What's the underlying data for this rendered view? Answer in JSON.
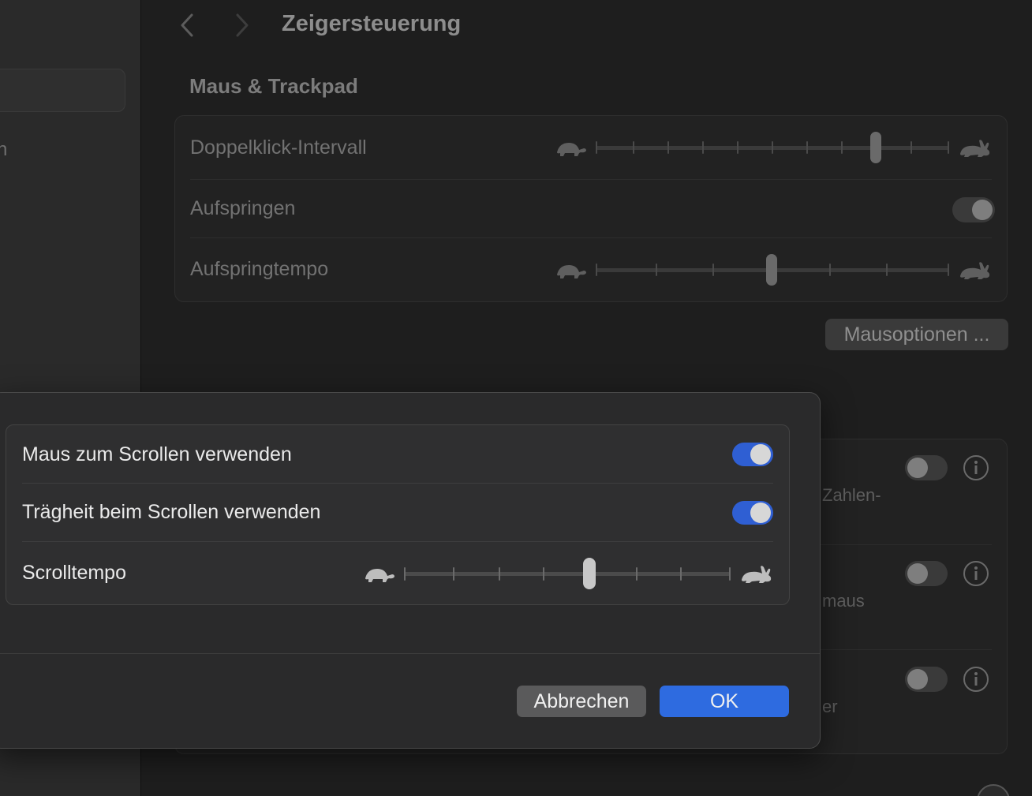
{
  "window": {
    "title": "Zeigersteuerung"
  },
  "sidebar": {
    "visible_fragment": "n"
  },
  "section": {
    "title": "Maus & Trackpad"
  },
  "settings": {
    "double_click": {
      "label": "Doppelklick-Intervall",
      "value_fraction": 0.8
    },
    "spring_loading": {
      "label": "Aufspringen",
      "enabled": true
    },
    "spring_speed": {
      "label": "Aufspringtempo",
      "value_fraction": 0.5
    },
    "mouse_options_button": "Mausoptionen ..."
  },
  "background_rows": [
    {
      "fragment": "Zahlen-",
      "enabled": false
    },
    {
      "fragment": "maus",
      "enabled": false
    },
    {
      "fragment": "er",
      "enabled": false
    }
  ],
  "dialog": {
    "scroll_with_mouse": {
      "label": "Maus zum Scrollen verwenden",
      "enabled": true
    },
    "scroll_inertia": {
      "label": "Trägheit beim Scrollen verwenden",
      "enabled": true
    },
    "scroll_speed": {
      "label": "Scrolltempo",
      "value_fraction": 0.5
    },
    "cancel_label": "Abbrechen",
    "ok_label": "OK"
  },
  "colors": {
    "accent": "#2e6be0",
    "toggle_on": "#2f5fd3",
    "dialog_bg": "#2a2a2b",
    "window_bg": "#1e1e1e"
  },
  "icons": [
    "chevron-left-icon",
    "chevron-right-icon",
    "turtle-icon",
    "rabbit-icon",
    "info-icon",
    "help-icon"
  ]
}
